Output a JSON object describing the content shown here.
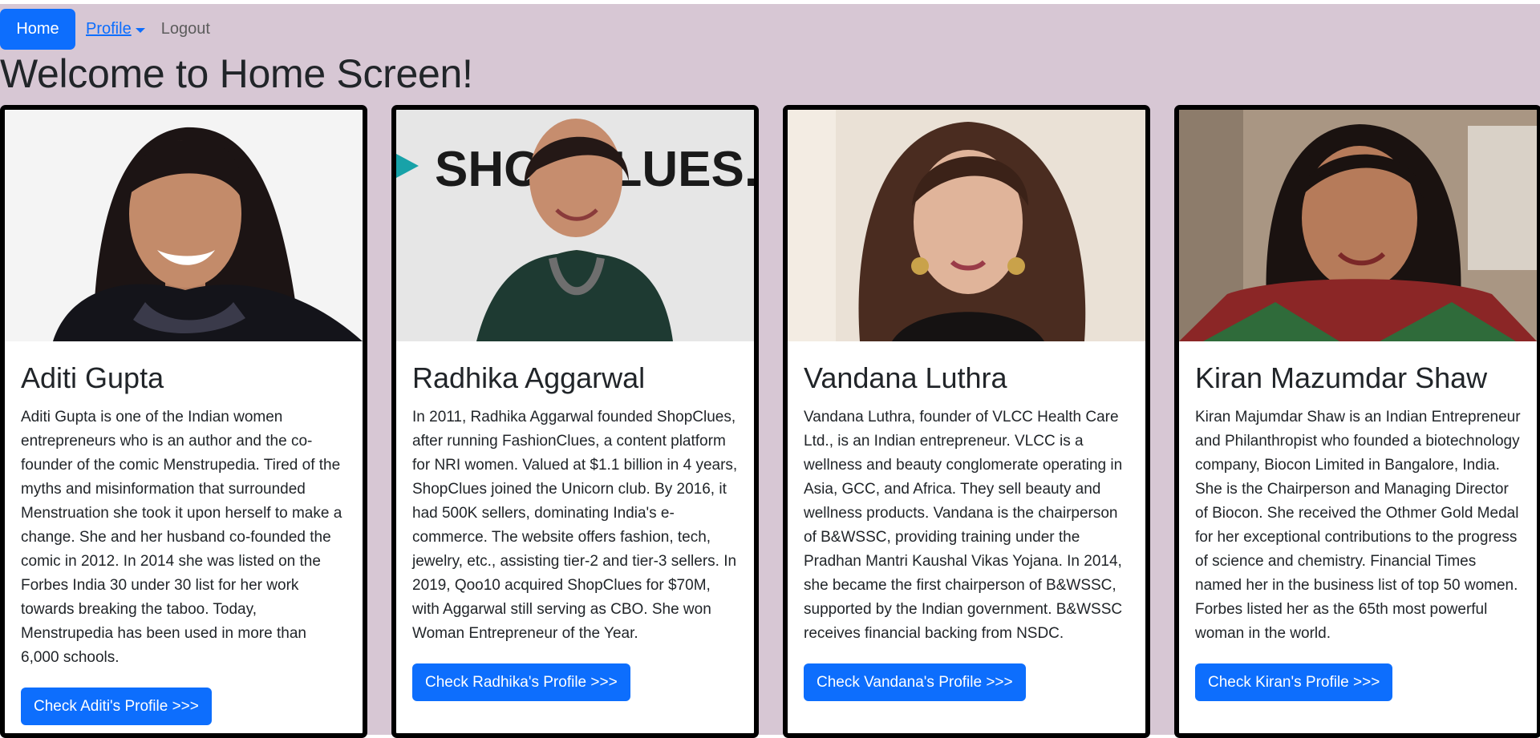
{
  "nav": {
    "home_label": "Home",
    "profile_label": "Profile",
    "logout_label": "Logout"
  },
  "page": {
    "title": "Welcome to Home Screen!"
  },
  "cards": [
    {
      "name": "Aditi Gupta",
      "text": "Aditi Gupta is one of the Indian women entrepreneurs who is an author and the co-founder of the comic Menstrupedia. Tired of the myths and misinformation that surrounded Menstruation she took it upon herself to make a change. She and her husband co-founded the comic in 2012. In 2014 she was listed on the Forbes India 30 under 30 list for her work towards breaking the taboo. Today, Menstrupedia has been used in more than 6,000 schools.",
      "button": "Check Aditi's Profile >>>"
    },
    {
      "name": "Radhika Aggarwal",
      "text": "In 2011, Radhika Aggarwal founded ShopClues, after running FashionClues, a content platform for NRI women. Valued at $1.1 billion in 4 years, ShopClues joined the Unicorn club. By 2016, it had 500K sellers, dominating India's e-commerce. The website offers fashion, tech, jewelry, etc., assisting tier-2 and tier-3 sellers. In 2019, Qoo10 acquired ShopClues for $70M, with Aggarwal still serving as CBO. She won Woman Entrepreneur of the Year.",
      "button": "Check Radhika's Profile >>>",
      "photo_logo": "SHOPCLUES.COM"
    },
    {
      "name": "Vandana Luthra",
      "text": "Vandana Luthra, founder of VLCC Health Care Ltd., is an Indian entrepreneur. VLCC is a wellness and beauty conglomerate operating in Asia, GCC, and Africa. They sell beauty and wellness products. Vandana is the chairperson of B&WSSC, providing training under the Pradhan Mantri Kaushal Vikas Yojana. In 2014, she became the first chairperson of B&WSSC, supported by the Indian government. B&WSSC receives financial backing from NSDC.",
      "button": "Check Vandana's Profile >>>"
    },
    {
      "name": "Kiran Mazumdar Shaw",
      "text": "Kiran Majumdar Shaw is an Indian Entrepreneur and Philanthropist who founded a biotechnology company, Biocon Limited in Bangalore, India. She is the Chairperson and Managing Director of Biocon. She received the Othmer Gold Medal for her exceptional contributions to the progress of science and chemistry. Financial Times named her in the business list of top 50 women. Forbes listed her as the 65th most powerful woman in the world.",
      "button": "Check Kiran's Profile >>>"
    }
  ],
  "colors": {
    "page_background": "#d7c7d4",
    "primary": "#0d6efd",
    "card_border": "#000000"
  }
}
